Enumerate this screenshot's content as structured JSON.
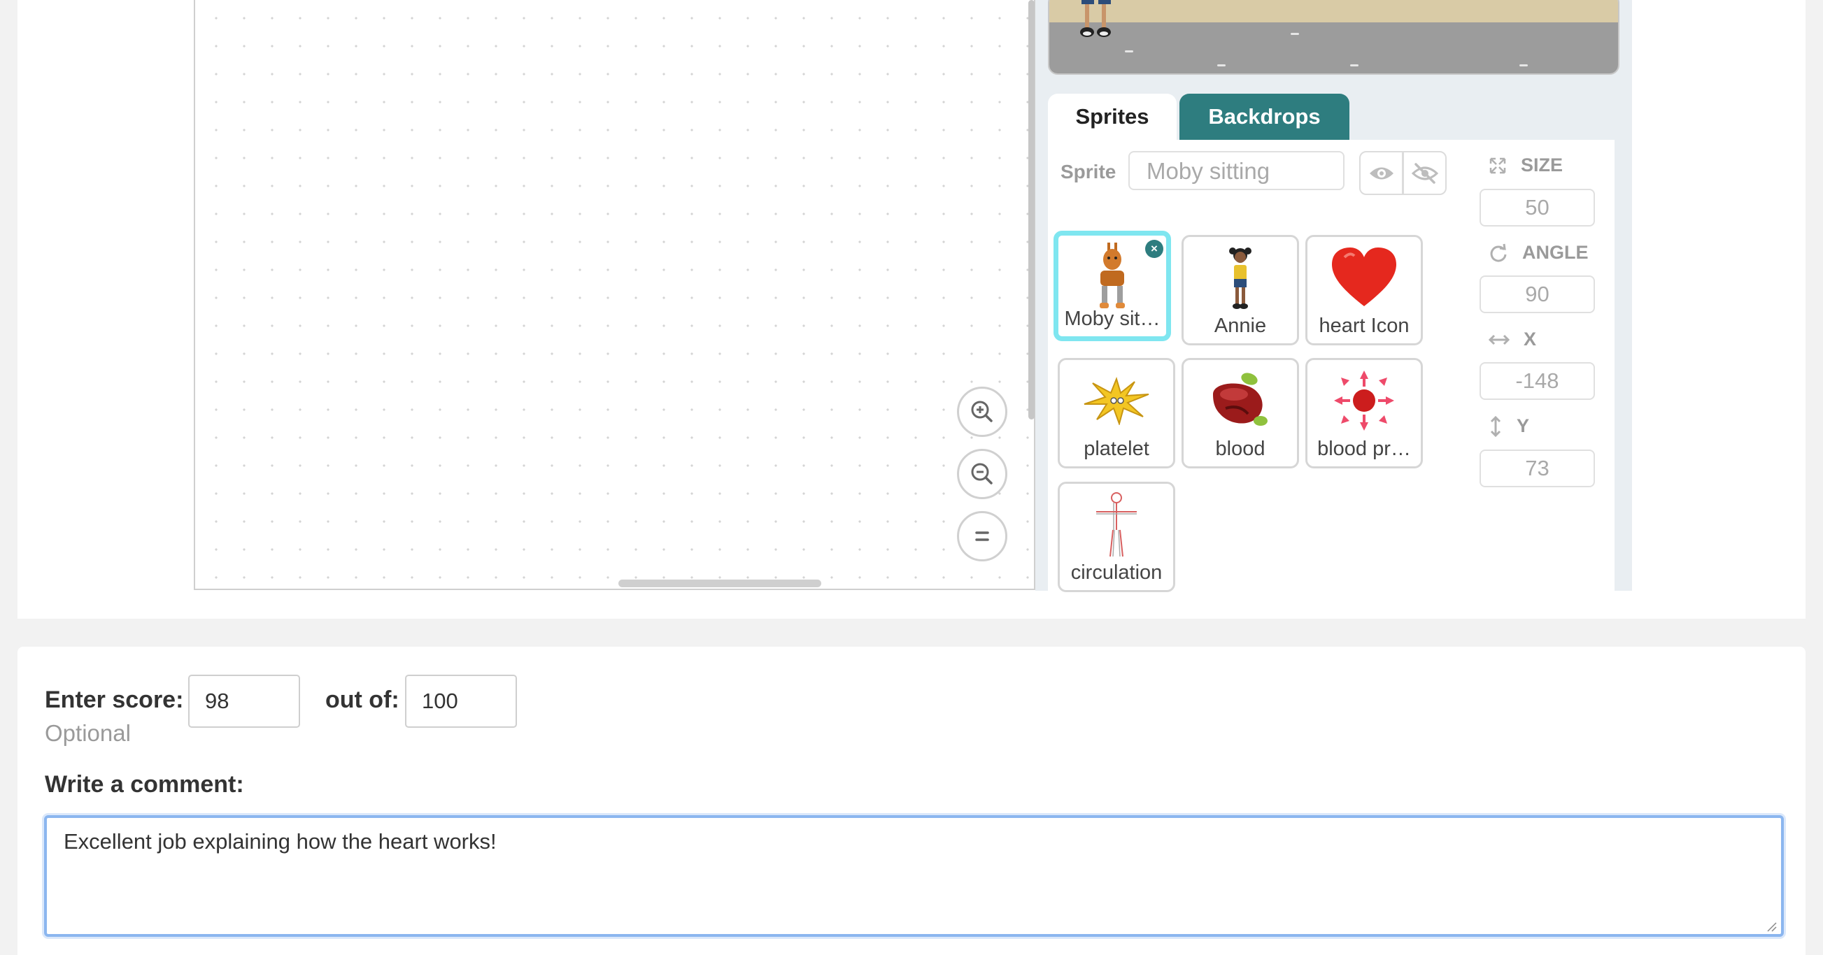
{
  "tabs": {
    "sprites": "Sprites",
    "backdrops": "Backdrops"
  },
  "sprite_info": {
    "label": "Sprite",
    "name_value": "Moby sitting",
    "size_label": "SIZE",
    "size_value": "50",
    "angle_label": "ANGLE",
    "angle_value": "90",
    "x_label": "X",
    "x_value": "-148",
    "y_label": "Y",
    "y_value": "73"
  },
  "sprites": [
    {
      "name": "Moby sit…",
      "icon": "moby-sitting-icon",
      "selected": true
    },
    {
      "name": "Annie",
      "icon": "annie-icon",
      "selected": false
    },
    {
      "name": "heart Icon",
      "icon": "heart-icon",
      "selected": false
    },
    {
      "name": "platelet",
      "icon": "platelet-icon",
      "selected": false
    },
    {
      "name": "blood",
      "icon": "blood-icon",
      "selected": false
    },
    {
      "name": "blood pr…",
      "icon": "blood-pressure-icon",
      "selected": false
    },
    {
      "name": "circulation",
      "icon": "circulation-icon",
      "selected": false
    }
  ],
  "grading": {
    "score_label": "Enter score:",
    "score_value": "98",
    "out_of_label": "out of:",
    "out_of_value": "100",
    "optional_label": "Optional",
    "comment_label": "Write a comment:",
    "comment_value": "Excellent job explaining how the heart works!"
  },
  "colors": {
    "accent_teal": "#2e7d7f",
    "selected_cyan": "#7fe6f0",
    "focus_blue": "#8bb6ef"
  }
}
